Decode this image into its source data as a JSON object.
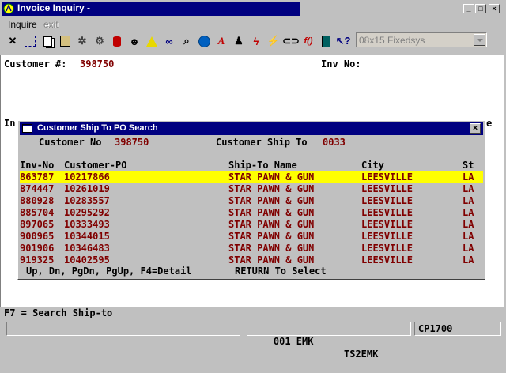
{
  "window": {
    "title": "Invoice Inquiry -"
  },
  "menu": {
    "items": [
      "Inquire",
      "exit"
    ]
  },
  "toolbar": {
    "icons": [
      "close-x-icon",
      "select-icon",
      "copy-icon",
      "paste-icon",
      "settings-icon",
      "config-icon",
      "database-icon",
      "user-icon",
      "warning-icon",
      "binoculars-icon",
      "search-icon",
      "globe-icon",
      "letter-a-icon",
      "person-icon",
      "lightning-icon",
      "flash-doc-icon",
      "link-icon",
      "function-icon",
      "list-icon",
      "help-pointer-icon"
    ],
    "font_select": "08x15 Fixedsys"
  },
  "terminal": {
    "customer_label": "Customer #:",
    "customer_value": "398750",
    "inv_no_label": "Inv No:",
    "clipped_left": "In",
    "clipped_right": "e",
    "footer": "F7 = Search Ship-to"
  },
  "dialog": {
    "title": "Customer Ship To PO Search",
    "customer_no_label": "Customer No",
    "customer_no_value": "398750",
    "ship_to_label": "Customer Ship To",
    "ship_to_value": "0033",
    "columns": [
      "Inv-No",
      "Customer-PO",
      "Ship-To Name",
      "City",
      "St"
    ],
    "rows": [
      [
        "863787",
        "10217866",
        "STAR PAWN & GUN",
        "LEESVILLE",
        "LA"
      ],
      [
        "874447",
        "10261019",
        "STAR PAWN & GUN",
        "LEESVILLE",
        "LA"
      ],
      [
        "880928",
        "10283557",
        "STAR PAWN & GUN",
        "LEESVILLE",
        "LA"
      ],
      [
        "885704",
        "10295292",
        "STAR PAWN & GUN",
        "LEESVILLE",
        "LA"
      ],
      [
        "897065",
        "10333493",
        "STAR PAWN & GUN",
        "LEESVILLE",
        "LA"
      ],
      [
        "900965",
        "10344015",
        "STAR PAWN & GUN",
        "LEESVILLE",
        "LA"
      ],
      [
        "901906",
        "10346483",
        "STAR PAWN & GUN",
        "LEESVILLE",
        "LA"
      ],
      [
        "919325",
        "10402595",
        "STAR PAWN & GUN",
        "LEESVILLE",
        "LA"
      ]
    ],
    "keys_hint": "Up, Dn, PgDn, PgUp, F4=Detail",
    "return_hint": "RETURN To Select"
  },
  "status": {
    "user": "001 EMK",
    "session": "TS2EMK",
    "code": "CP1700"
  }
}
